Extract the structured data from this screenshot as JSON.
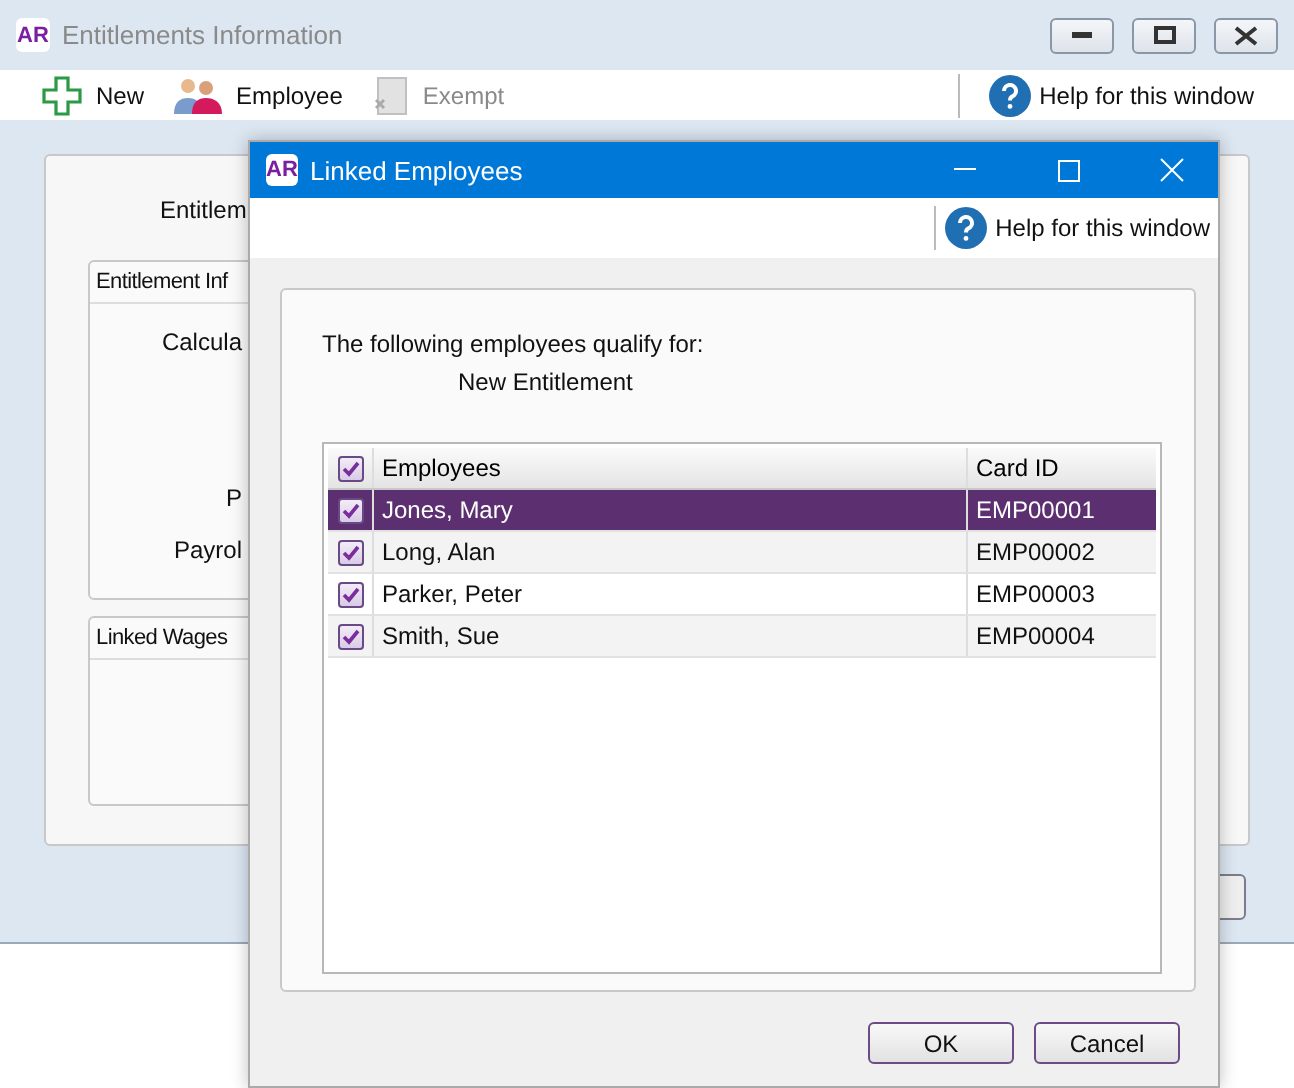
{
  "main_window": {
    "app_badge": "AR",
    "title": "Entitlements Information",
    "toolbar": [
      {
        "kind": "new",
        "label": "New",
        "disabled": false
      },
      {
        "kind": "employee",
        "label": "Employee",
        "disabled": false
      },
      {
        "kind": "exempt",
        "label": "Exempt",
        "disabled": true
      }
    ],
    "help": "Help for this window",
    "form_label": "Entitlem",
    "groups": [
      {
        "title": "Entitlement Inf",
        "labels": [
          "Calcula",
          "P",
          "Payrol"
        ]
      },
      {
        "title": "Linked Wages"
      }
    ]
  },
  "dialog": {
    "app_badge": "AR",
    "title": "Linked Employees",
    "help": "Help for this window",
    "intro": "The following employees qualify for:",
    "entitlement": "New Entitlement",
    "table": {
      "all_checked": true,
      "columns": [
        "Employees",
        "Card ID"
      ],
      "rows": [
        {
          "name": "Jones, Mary",
          "card_id": "EMP00001",
          "checked": true,
          "selected": true
        },
        {
          "name": "Long, Alan",
          "card_id": "EMP00002",
          "checked": true,
          "selected": false
        },
        {
          "name": "Parker, Peter",
          "card_id": "EMP00003",
          "checked": true,
          "selected": false
        },
        {
          "name": "Smith, Sue",
          "card_id": "EMP00004",
          "checked": true,
          "selected": false
        }
      ]
    },
    "buttons": [
      "OK",
      "Cancel"
    ]
  }
}
